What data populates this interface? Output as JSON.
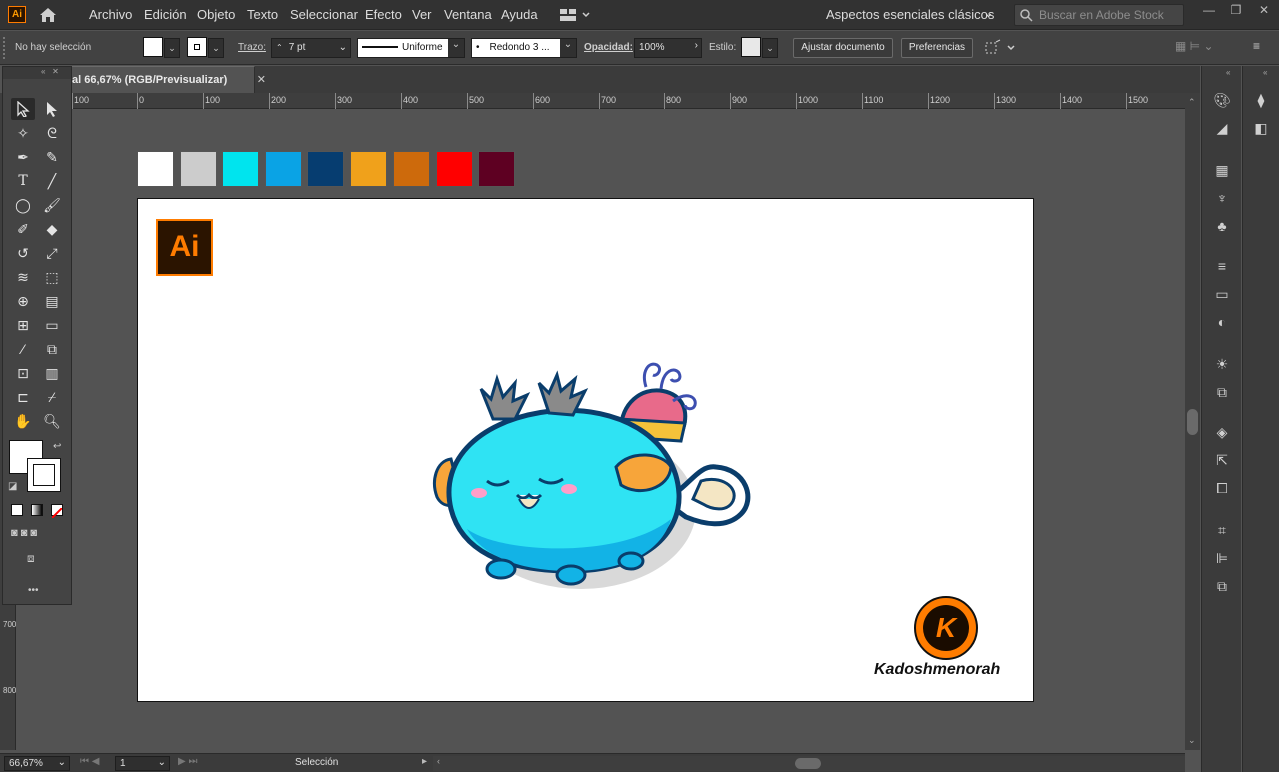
{
  "app": {
    "badge": "Ai"
  },
  "menu": [
    "Archivo",
    "Edición",
    "Objeto",
    "Texto",
    "Seleccionar",
    "Efecto",
    "Ver",
    "Ventana",
    "Ayuda"
  ],
  "workspace": {
    "label": "Aspectos esenciales clásicos",
    "caret": "⌄"
  },
  "search": {
    "placeholder": "Buscar en Adobe Stock"
  },
  "window_buttons": {
    "minimize": "—",
    "restore": "❐",
    "close": "✕"
  },
  "control": {
    "selection_status": "No hay selección",
    "stroke_label": "Trazo:",
    "stroke_weight": "7 pt",
    "stroke_profile": "Uniforme",
    "brush": "Redondo 3 ...",
    "opacity_label": "Opacidad:",
    "opacity_value": "100%",
    "style_label": "Estilo:",
    "fit_doc": "Ajustar documento",
    "prefs": "Preferencias"
  },
  "document": {
    "tab_title": "al 66,67% (RGB/Previsualizar)",
    "close": "✕"
  },
  "ruler": {
    "h": [
      "100",
      "0",
      "100",
      "200",
      "300",
      "400",
      "500",
      "600",
      "700",
      "800",
      "900",
      "1000",
      "1100",
      "1200",
      "1300",
      "1400",
      "1500"
    ],
    "v": [
      "700",
      "800"
    ]
  },
  "palette": [
    "#ffffff",
    "#cccccc",
    "#00e4ee",
    "#0aa3e5",
    "#063d70",
    "#f0a11b",
    "#cd6a0c",
    "#ff0000",
    "#5e0022"
  ],
  "artboard": {
    "ai_logo": "Ai",
    "brand": "Kadoshmenorah",
    "brand_letter": "K"
  },
  "colors": {
    "ai_orange": "#ff7c00",
    "ai_bg": "#2b1400",
    "axie_blue": "#2fe3f3",
    "axie_dark": "#0a3d6b",
    "fin_orange": "#f7a53a"
  },
  "toolbar": {
    "more": "•••"
  },
  "status": {
    "zoom": "66,67%",
    "artboard_num": "1",
    "tool": "Selección"
  }
}
